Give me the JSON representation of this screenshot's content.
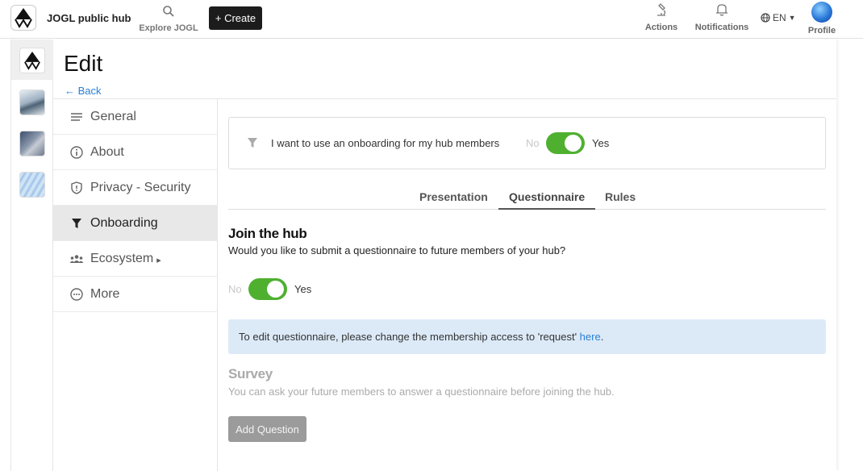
{
  "topbar": {
    "brand": "JOGL public hub",
    "explore_label": "Explore JOGL",
    "create_label": "+ Create",
    "actions_label": "Actions",
    "notifications_label": "Notifications",
    "language": "EN",
    "profile_label": "Profile"
  },
  "page": {
    "title": "Edit",
    "back_label": "← Back"
  },
  "sidebar": {
    "items": [
      {
        "label": "General",
        "icon": "lines-icon"
      },
      {
        "label": "About",
        "icon": "info-icon"
      },
      {
        "label": "Privacy - Security",
        "icon": "shield-icon"
      },
      {
        "label": "Onboarding",
        "icon": "funnel-icon",
        "active": true
      },
      {
        "label": "Ecosystem",
        "icon": "people-icon",
        "suffix": "▸"
      },
      {
        "label": "More",
        "icon": "dots-circle-icon"
      }
    ]
  },
  "onboarding": {
    "question": "I want to use an onboarding for my hub members",
    "no": "No",
    "yes": "Yes",
    "enabled": true
  },
  "tabs": [
    {
      "label": "Presentation"
    },
    {
      "label": "Questionnaire",
      "active": true
    },
    {
      "label": "Rules"
    }
  ],
  "join": {
    "heading": "Join the hub",
    "description": "Would you like to submit a questionnaire to future members of your hub?",
    "no": "No",
    "yes": "Yes",
    "enabled": true
  },
  "info": {
    "text": "To edit questionnaire, please change the membership access to 'request' ",
    "link": "here",
    "end": "."
  },
  "survey": {
    "heading": "Survey",
    "description": "You can ask your future members to answer a questionnaire before joining the hub.",
    "add_button": "Add Question"
  },
  "colors": {
    "toggle_on": "#4fb030",
    "link": "#2a7fd6",
    "info_bg": "#dceaf8",
    "create_bg": "#1c1c1c"
  }
}
